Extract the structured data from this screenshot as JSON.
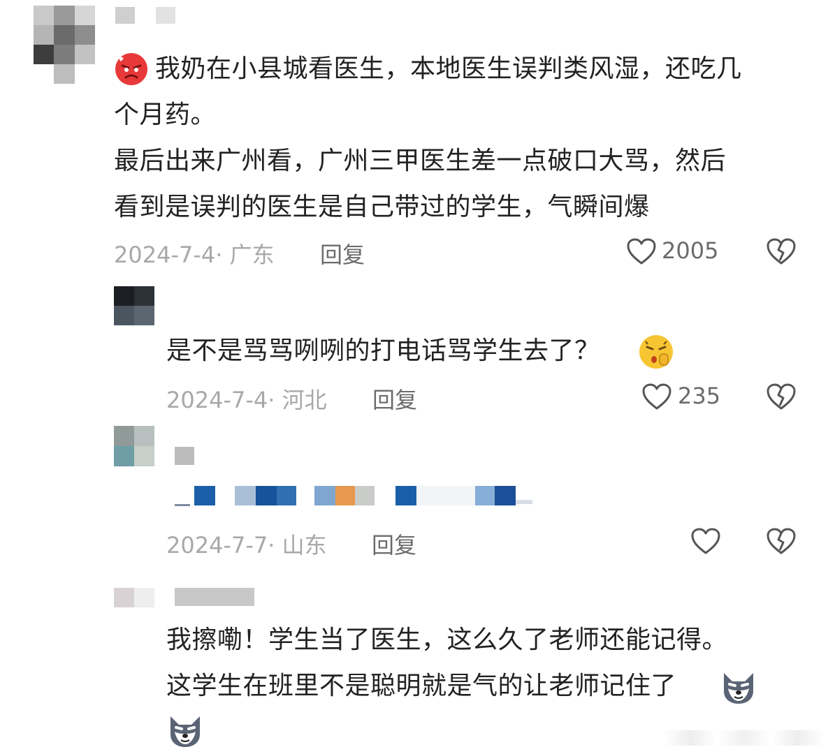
{
  "comments": [
    {
      "text_line1": "我奶在小县城看医生，本地医生误判类风湿，还吃几",
      "text_line2": "个月药。",
      "text_line3": "最后出来广州看，广州三甲医生差一点破口大骂，然后",
      "text_line4": "看到是误判的医生是自己带过的学生，气瞬间爆",
      "date_loc": "2024-7-4· 广东",
      "reply_label": "回复",
      "likes": "2005",
      "leading_emoji": "angry-face-emoji"
    },
    {
      "text": "是不是骂骂咧咧的打电话骂学生去了？",
      "date_loc": "2024-7-4· 河北",
      "reply_label": "回复",
      "likes": "235",
      "trailing_emoji": "shushing-face-emoji"
    },
    {
      "date_loc": "2024-7-7· 山东",
      "reply_label": "回复",
      "likes": ""
    },
    {
      "text_line1": "我擦嘞！学生当了医生，这么久了老师还能记得。",
      "text_line2": "这学生在班里不是聪明就是气的让老师记住了",
      "trailing_emoji": "husky-dog-emoji"
    }
  ],
  "colors": {
    "text": "#222222",
    "meta": "#a8a8a8",
    "reply": "#6b6b6b",
    "icon": "#555555"
  }
}
